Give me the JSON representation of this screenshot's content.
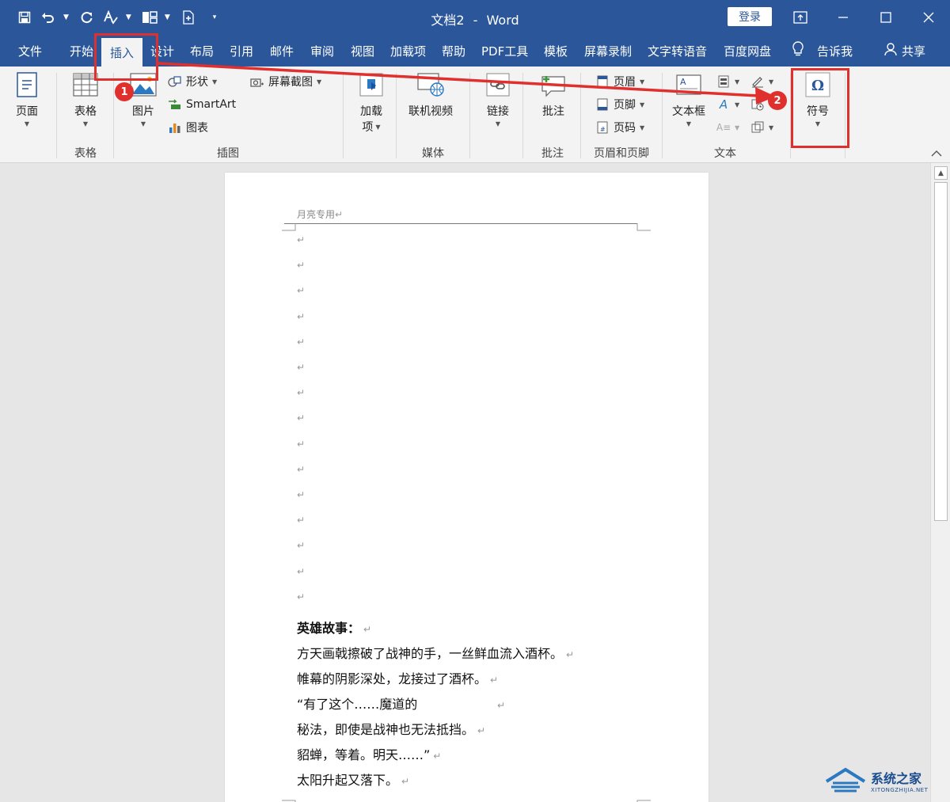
{
  "titlebar": {
    "doc_name": "文档2",
    "separator": "-",
    "app_name": "Word",
    "login_label": "登录"
  },
  "tabs": [
    {
      "label": "文件"
    },
    {
      "label": "开始"
    },
    {
      "label": "插入"
    },
    {
      "label": "设计"
    },
    {
      "label": "布局"
    },
    {
      "label": "引用"
    },
    {
      "label": "邮件"
    },
    {
      "label": "审阅"
    },
    {
      "label": "视图"
    },
    {
      "label": "加载项"
    },
    {
      "label": "帮助"
    },
    {
      "label": "PDF工具"
    },
    {
      "label": "模板"
    },
    {
      "label": "屏幕录制"
    },
    {
      "label": "文字转语音"
    },
    {
      "label": "百度网盘"
    },
    {
      "label": "告诉我"
    },
    {
      "label": "共享"
    }
  ],
  "ribbon": {
    "pages_btn": "页面",
    "table_btn": "表格",
    "table_group": "表格",
    "picture_btn": "图片",
    "shapes_btn": "形状",
    "smartart_btn": "SmartArt",
    "chart_btn": "图表",
    "screenshot_btn": "屏幕截图",
    "illustrations_group": "插图",
    "addins_btn_line1": "加载",
    "addins_btn_line2": "项",
    "online_video_btn": "联机视频",
    "media_group": "媒体",
    "link_btn": "链接",
    "comment_btn": "批注",
    "comment_group": "批注",
    "header_btn": "页眉",
    "footer_btn": "页脚",
    "page_number_btn": "页码",
    "header_footer_group": "页眉和页脚",
    "textbox_btn": "文本框",
    "text_group": "文本",
    "symbol_btn": "符号"
  },
  "document": {
    "header_text": "月亮专用",
    "paragraph_mark": "↵",
    "lines": [
      {
        "text": "英雄故事：",
        "bold": true
      },
      {
        "text": "方天画戟擦破了战神的手，一丝鲜血流入酒杯。"
      },
      {
        "text": "帷幕的阴影深处，龙接过了酒杯。"
      },
      {
        "text": "“有了这个……魔道的                   "
      },
      {
        "text": "秘法，即使是战神也无法抵挡。"
      },
      {
        "text": "貂蝉，等着。明天……”"
      },
      {
        "text": "太阳升起又落下。"
      }
    ]
  },
  "annotations": {
    "badge1": "1",
    "badge2": "2",
    "color": "#e0302e"
  },
  "watermark": {
    "main": "系统之家",
    "sub": "XITONGZHIJIA.NET"
  },
  "colors": {
    "word_blue": "#2b579a",
    "ribbon_bg": "#f3f3f3"
  }
}
